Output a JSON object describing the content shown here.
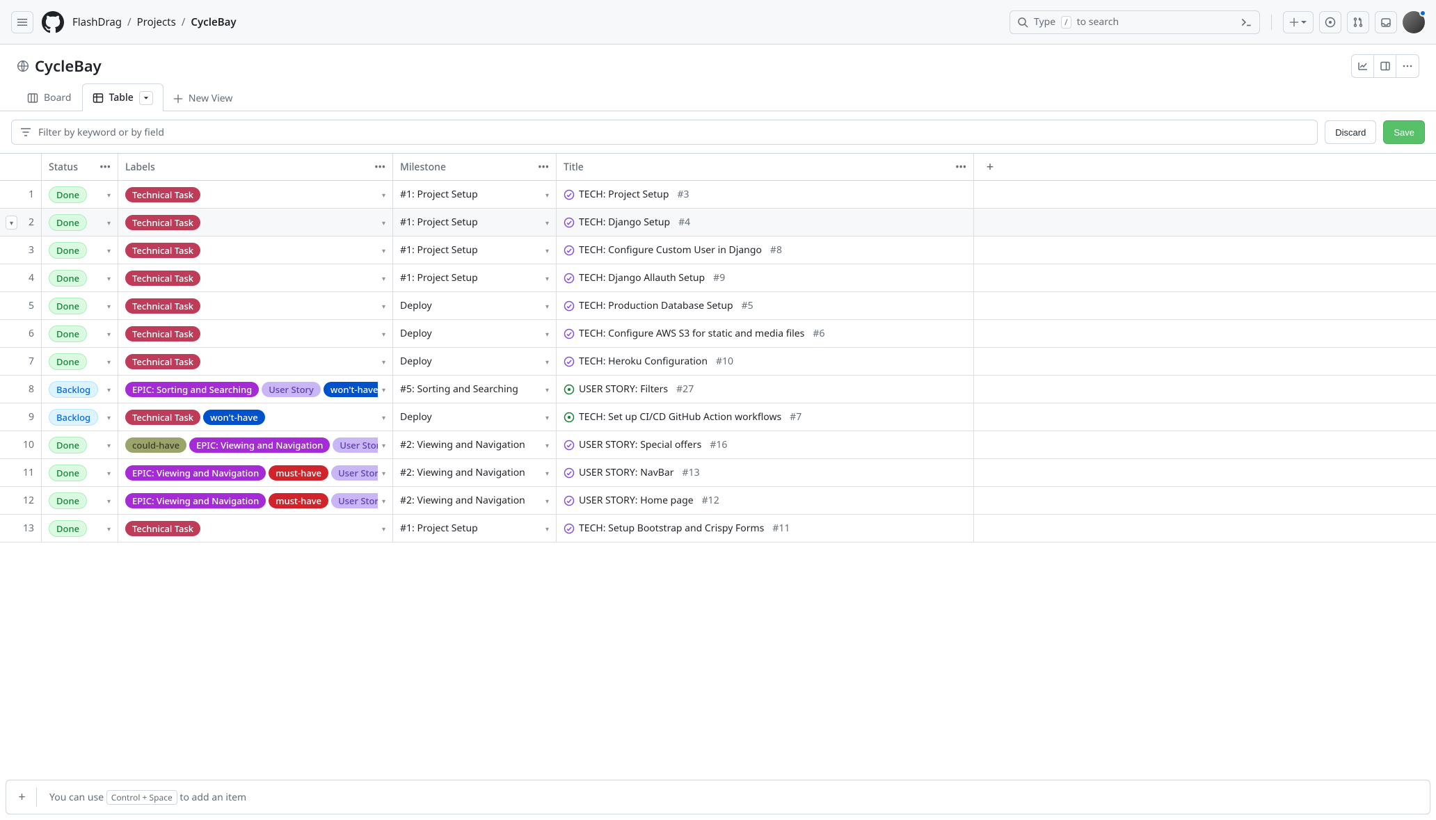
{
  "breadcrumb": {
    "owner": "FlashDrag",
    "section": "Projects",
    "project": "CycleBay"
  },
  "project": {
    "title": "CycleBay"
  },
  "search": {
    "placeholder_pre": "Type ",
    "placeholder_key": "/",
    "placeholder_post": " to search"
  },
  "views": {
    "board": "Board",
    "table": "Table",
    "new": "New View"
  },
  "filter": {
    "placeholder": "Filter by keyword or by field"
  },
  "buttons": {
    "discard": "Discard",
    "save": "Save"
  },
  "columns": {
    "status": "Status",
    "labels": "Labels",
    "milestone": "Milestone",
    "title": "Title"
  },
  "label_colors": {
    "Technical Task": "#bf3c58",
    "EPIC: Sorting and Searching": "#a42bd6",
    "EPIC: Viewing and Navigation": "#a42bd6",
    "User Story": "#c9b6f5",
    "won't-have": "#0052cc",
    "must-have": "#d1232a",
    "could-have": "#9ca36b"
  },
  "label_text_colors": {
    "User Story": "#5b3fb2",
    "could-have": "#3b3f20"
  },
  "status_styles": {
    "Done": "status-done",
    "Backlog": "status-backlog"
  },
  "rows": [
    {
      "n": 1,
      "status": "Done",
      "labels": [
        "Technical Task"
      ],
      "milestone": "#1: Project Setup",
      "title": "TECH: Project Setup",
      "num": "#3",
      "state": "closed"
    },
    {
      "n": 2,
      "status": "Done",
      "labels": [
        "Technical Task"
      ],
      "milestone": "#1: Project Setup",
      "title": "TECH: Django Setup",
      "num": "#4",
      "state": "closed",
      "selected": true
    },
    {
      "n": 3,
      "status": "Done",
      "labels": [
        "Technical Task"
      ],
      "milestone": "#1: Project Setup",
      "title": "TECH: Configure Custom User in Django",
      "num": "#8",
      "state": "closed"
    },
    {
      "n": 4,
      "status": "Done",
      "labels": [
        "Technical Task"
      ],
      "milestone": "#1: Project Setup",
      "title": "TECH: Django Allauth Setup",
      "num": "#9",
      "state": "closed"
    },
    {
      "n": 5,
      "status": "Done",
      "labels": [
        "Technical Task"
      ],
      "milestone": "Deploy",
      "title": "TECH: Production Database Setup",
      "num": "#5",
      "state": "closed"
    },
    {
      "n": 6,
      "status": "Done",
      "labels": [
        "Technical Task"
      ],
      "milestone": "Deploy",
      "title": "TECH: Configure AWS S3 for static and media files",
      "num": "#6",
      "state": "closed"
    },
    {
      "n": 7,
      "status": "Done",
      "labels": [
        "Technical Task"
      ],
      "milestone": "Deploy",
      "title": "TECH: Heroku Configuration",
      "num": "#10",
      "state": "closed"
    },
    {
      "n": 8,
      "status": "Backlog",
      "labels": [
        "EPIC: Sorting and Searching",
        "User Story",
        "won't-have"
      ],
      "milestone": "#5: Sorting and Searching",
      "title": "USER STORY: Filters",
      "num": "#27",
      "state": "open"
    },
    {
      "n": 9,
      "status": "Backlog",
      "labels": [
        "Technical Task",
        "won't-have"
      ],
      "milestone": "Deploy",
      "title": "TECH: Set up CI/CD GitHub Action workflows",
      "num": "#7",
      "state": "open"
    },
    {
      "n": 10,
      "status": "Done",
      "labels": [
        "could-have",
        "EPIC: Viewing and Navigation",
        "User Story"
      ],
      "milestone": "#2: Viewing and Navigation",
      "title": "USER STORY: Special offers",
      "num": "#16",
      "state": "closed"
    },
    {
      "n": 11,
      "status": "Done",
      "labels": [
        "EPIC: Viewing and Navigation",
        "must-have",
        "User Story"
      ],
      "milestone": "#2: Viewing and Navigation",
      "title": "USER STORY: NavBar",
      "num": "#13",
      "state": "closed"
    },
    {
      "n": 12,
      "status": "Done",
      "labels": [
        "EPIC: Viewing and Navigation",
        "must-have",
        "User Story"
      ],
      "milestone": "#2: Viewing and Navigation",
      "title": "USER STORY: Home page",
      "num": "#12",
      "state": "closed"
    },
    {
      "n": 13,
      "status": "Done",
      "labels": [
        "Technical Task"
      ],
      "milestone": "#1: Project Setup",
      "title": "TECH: Setup Bootstrap and Crispy Forms",
      "num": "#11",
      "state": "closed"
    }
  ],
  "bottom": {
    "pre": "You can use ",
    "kbd": "Control + Space",
    "post": " to add an item"
  }
}
